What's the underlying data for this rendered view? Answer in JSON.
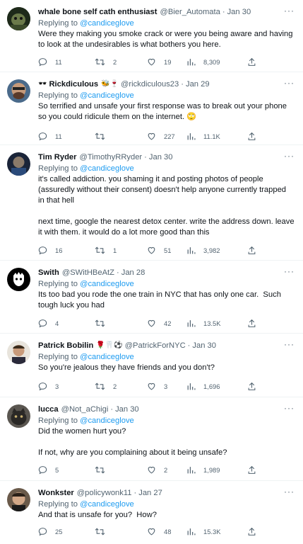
{
  "tweets": [
    {
      "name": "whale bone self cath enthusiast",
      "handle": "@Bier_Automata",
      "time": "Jan 30",
      "replying_prefix": "Replying to ",
      "replying_to": "@candiceglove",
      "body": "Were they making you smoke crack or were you being aware and having\nto look at the undesirables is what bothers you here.",
      "counts": {
        "reply": "11",
        "retweet": "2",
        "like": "19",
        "views": "8,309"
      }
    },
    {
      "name": "Rickdiculous",
      "handle": "@rickdiculous23",
      "time": "Jan 29",
      "replying_prefix": "Replying to ",
      "replying_to": "@candiceglove",
      "body": "So terrified and unsafe your first response was to break out your phone\nso you could ridicule them on the internet. 🙄",
      "counts": {
        "reply": "11",
        "retweet": "",
        "like": "227",
        "views": "11.1K"
      }
    },
    {
      "name": "Tim Ryder",
      "handle": "@TimothyRRyder",
      "time": "Jan 30",
      "replying_prefix": "Replying to ",
      "replying_to": "@candiceglove",
      "body": "it's called addiction. you shaming it and posting photos of people\n(assuredly without their consent) doesn't help anyone currently trapped\nin that hell\n\nnext time, google the nearest detox center. write the address down. leave\nit with them. it would do a lot more good than this",
      "counts": {
        "reply": "16",
        "retweet": "1",
        "like": "51",
        "views": "3,982"
      }
    },
    {
      "name": "Swith",
      "handle": "@SWitHBeAtZ",
      "time": "Jan 28",
      "replying_prefix": "Replying to ",
      "replying_to": "@candiceglove",
      "body": "Its too bad you rode the one train in NYC that has only one car.  Such\ntough luck you had",
      "counts": {
        "reply": "4",
        "retweet": "",
        "like": "42",
        "views": "13.5K"
      }
    },
    {
      "name": "Patrick Bobilin",
      "handle": "@PatrickForNYC",
      "time": "Jan 30",
      "replying_prefix": "Replying to ",
      "replying_to": "@candiceglove",
      "body": "So you're jealous they have friends and you don't?",
      "counts": {
        "reply": "3",
        "retweet": "2",
        "like": "3",
        "views": "1,696"
      }
    },
    {
      "name": "lucca",
      "handle": "@Not_aChigi",
      "time": "Jan 30",
      "replying_prefix": "Replying to ",
      "replying_to": "@candiceglove",
      "body": "Did the women hurt you?\n\nIf not, why are you complaining about it being unsafe?",
      "counts": {
        "reply": "5",
        "retweet": "",
        "like": "2",
        "views": "1,989"
      }
    },
    {
      "name": "Wonkster",
      "handle": "@policywonk11",
      "time": "Jan 27",
      "replying_prefix": "Replying to ",
      "replying_to": "@candiceglove",
      "body": "And that is unsafe for you?  How?",
      "counts": {
        "reply": "25",
        "retweet": "",
        "like": "48",
        "views": "15.3K"
      }
    }
  ],
  "icons": {
    "reply": "speech-bubble-icon",
    "retweet": "retweet-arrows-icon",
    "like": "heart-icon",
    "views": "bar-chart-icon",
    "share": "share-upload-icon",
    "more": "more-dots-icon"
  },
  "more_label": "···",
  "dot": "·"
}
